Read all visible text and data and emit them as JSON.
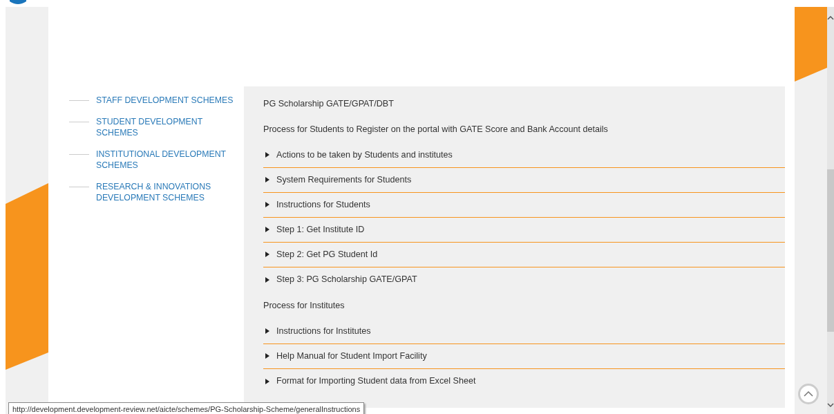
{
  "sidebar": {
    "items": [
      {
        "label": "STAFF DEVELOPMENT SCHEMES"
      },
      {
        "label": "STUDENT DEVELOPMENT SCHEMES"
      },
      {
        "label": "INSTITUTIONAL DEVELOPMENT SCHEMES"
      },
      {
        "label": "RESEARCH & INNOVATIONS DEVELOPMENT SCHEMES"
      }
    ]
  },
  "content": {
    "title": "PG Scholarship GATE/GPAT/DBT",
    "sections": [
      {
        "heading": "Process for Students to Register on the portal with GATE Score and Bank Account details",
        "items": [
          {
            "label": "Actions to be taken by Students and institutes",
            "expanded": false
          },
          {
            "label": "System Requirements for Students",
            "expanded": false
          },
          {
            "label": "Instructions for Students",
            "expanded": false
          },
          {
            "label": "Step 1: Get Institute ID",
            "expanded": false
          },
          {
            "label": "Step 2: Get PG Student Id",
            "expanded": false
          },
          {
            "label": "Step 3: PG Scholarship GATE/GPAT",
            "expanded": false
          }
        ]
      },
      {
        "heading": "Process for Institutes",
        "items": [
          {
            "label": "Instructions for Institutes",
            "expanded": false
          },
          {
            "label": "Help Manual for Student Import Facility",
            "expanded": false
          },
          {
            "label": "Format for Importing Student data from Excel Sheet",
            "expanded": false
          }
        ]
      }
    ]
  },
  "status_bar": {
    "url": "http://development.development-review.net/aicte/schemes/PG-Scholarship-Scheme/generalInstructions"
  }
}
